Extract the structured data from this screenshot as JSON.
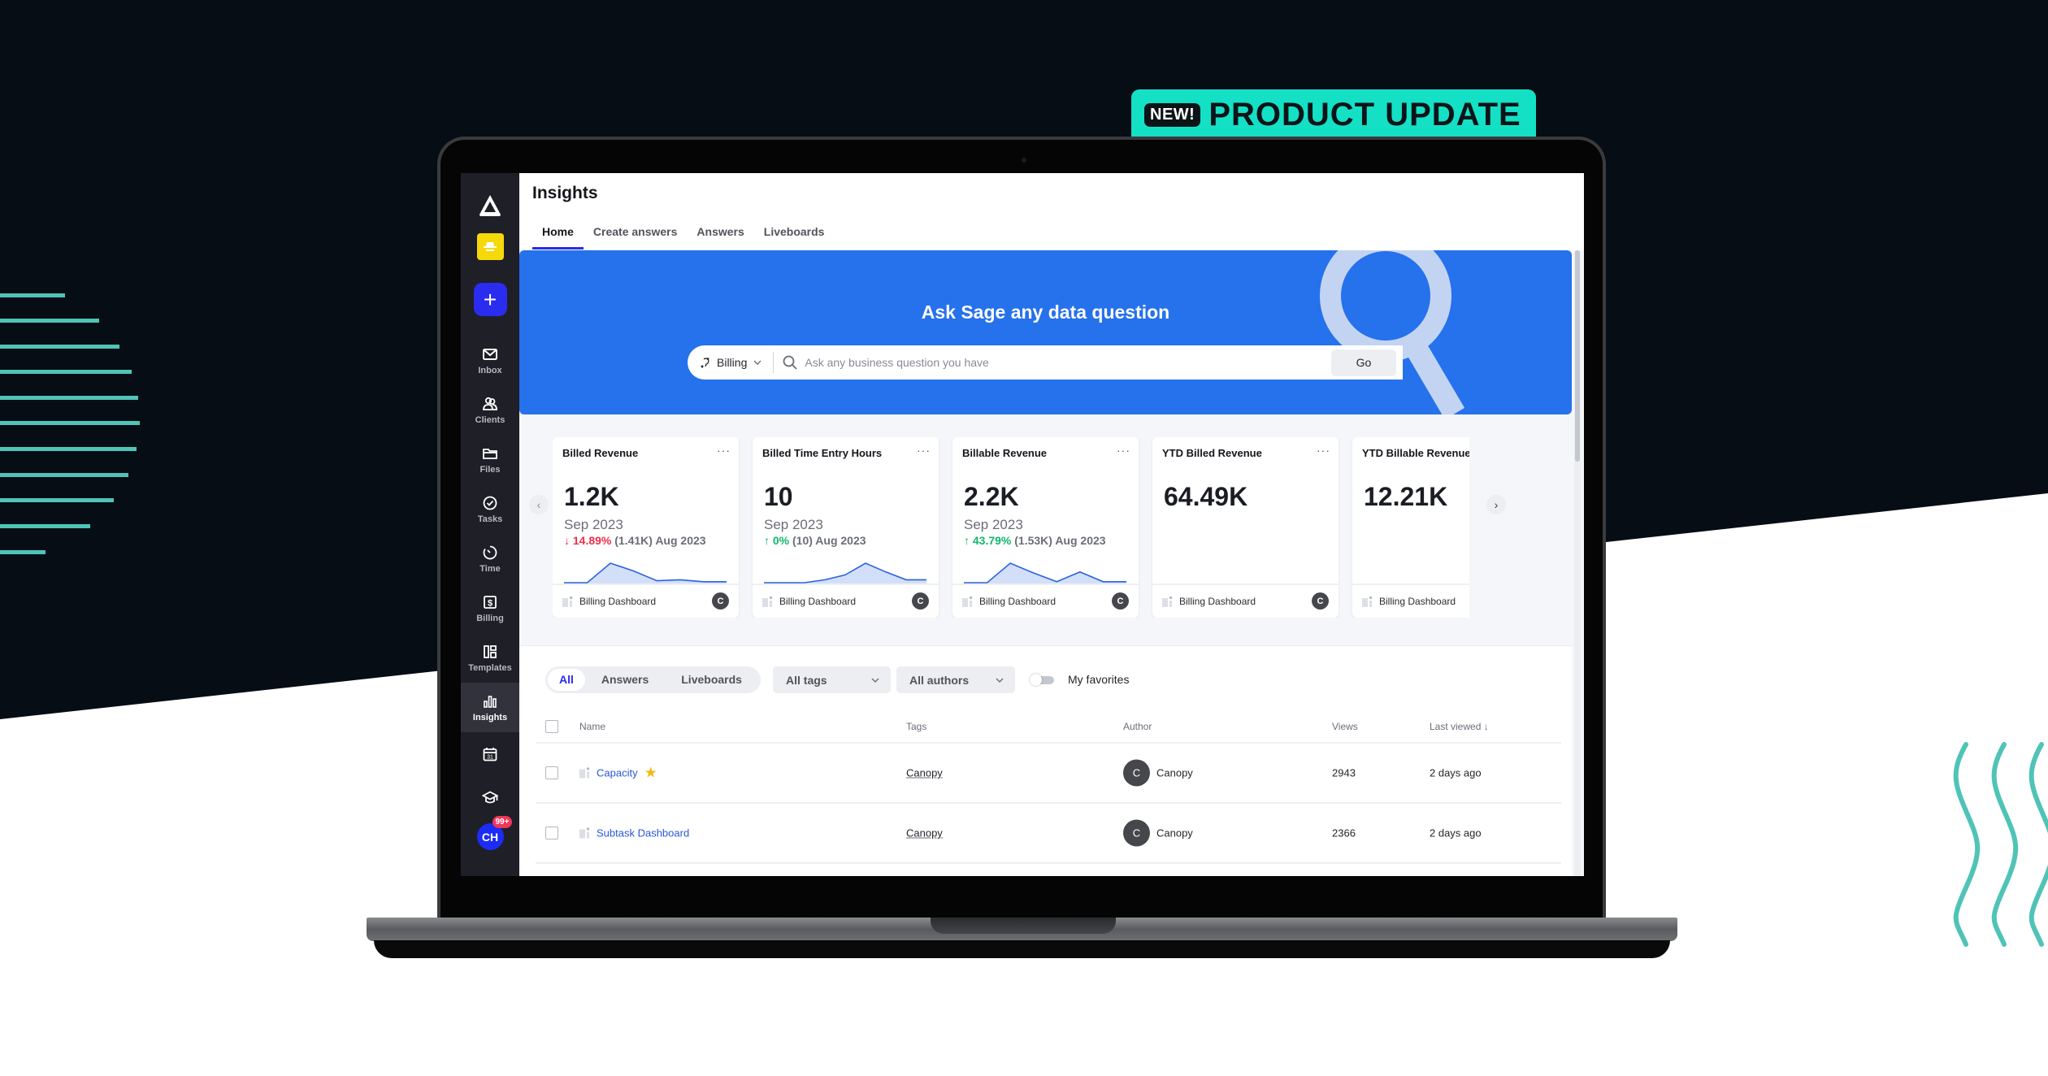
{
  "promo": {
    "badge": "NEW!",
    "title": "PRODUCT UPDATE",
    "accent": "#14e0c6",
    "background_dark": "#060d14"
  },
  "sidebar": {
    "items": [
      {
        "label": "Inbox",
        "icon": "mail-icon"
      },
      {
        "label": "Clients",
        "icon": "users-icon"
      },
      {
        "label": "Files",
        "icon": "folder-icon"
      },
      {
        "label": "Tasks",
        "icon": "check-circle-icon"
      },
      {
        "label": "Time",
        "icon": "timer-icon"
      },
      {
        "label": "Billing",
        "icon": "dollar-icon"
      },
      {
        "label": "Templates",
        "icon": "templates-icon"
      },
      {
        "label": "Insights",
        "icon": "bar-chart-icon",
        "active": true
      }
    ],
    "extra_icons": [
      "calendar-icon",
      "graduation-cap-icon"
    ],
    "avatar": {
      "initials": "CH",
      "badge": "99+"
    }
  },
  "header": {
    "title": "Insights",
    "tabs": [
      {
        "label": "Home",
        "active": true
      },
      {
        "label": "Create answers"
      },
      {
        "label": "Answers"
      },
      {
        "label": "Liveboards"
      }
    ]
  },
  "hero": {
    "title": "Ask Sage any data question",
    "scope": "Billing",
    "search_value": "",
    "search_placeholder": "Ask any business question you have",
    "go_label": "Go",
    "accent": "#2671ec"
  },
  "kpis": [
    {
      "title": "Billed Revenue",
      "value": "1.2K",
      "period": "Sep 2023",
      "direction": "down",
      "arrow": "↓",
      "delta": "14.89%",
      "compare": "(1.41K) Aug 2023",
      "source": "Billing Dashboard",
      "author": "C",
      "spark": [
        0,
        0,
        1,
        0.6,
        0.1,
        0.15,
        0.05,
        0.05
      ],
      "show_menu": true
    },
    {
      "title": "Billed Time Entry Hours",
      "value": "10",
      "period": "Sep 2023",
      "direction": "up",
      "arrow": "↑",
      "delta": "0%",
      "compare": "(10) Aug 2023",
      "source": "Billing Dashboard",
      "author": "C",
      "spark": [
        0,
        0,
        0,
        0.15,
        0.4,
        1,
        0.55,
        0.15,
        0.15
      ],
      "show_menu": true
    },
    {
      "title": "Billable Revenue",
      "value": "2.2K",
      "period": "Sep 2023",
      "direction": "up",
      "arrow": "↑",
      "delta": "43.79%",
      "compare": "(1.53K) Aug 2023",
      "source": "Billing Dashboard",
      "author": "C",
      "spark": [
        0,
        0,
        1,
        0.5,
        0.05,
        0.55,
        0.05,
        0.05
      ],
      "show_menu": true
    },
    {
      "title": "YTD Billed Revenue",
      "value": "64.49K",
      "period": "",
      "direction": "",
      "arrow": "",
      "delta": "",
      "compare": "",
      "source": "Billing Dashboard",
      "author": "C",
      "spark": [],
      "show_menu": true
    },
    {
      "title": "YTD Billable Revenue",
      "value": "12.21K",
      "period": "",
      "direction": "",
      "arrow": "",
      "delta": "",
      "compare": "",
      "source": "Billing Dashboard",
      "author": "",
      "spark": [],
      "show_menu": false
    }
  ],
  "filters": {
    "segments": [
      {
        "label": "All",
        "active": true
      },
      {
        "label": "Answers"
      },
      {
        "label": "Liveboards"
      }
    ],
    "tags": "All tags",
    "authors": "All authors",
    "favorites_label": "My favorites",
    "favorites_on": false
  },
  "table": {
    "columns": {
      "name": "Name",
      "tags": "Tags",
      "author": "Author",
      "views": "Views",
      "last_viewed": "Last viewed ↓"
    },
    "rows": [
      {
        "name": "Capacity",
        "favorite": true,
        "tag": "Canopy",
        "author_initial": "C",
        "author": "Canopy",
        "views": "2943",
        "last_viewed": "2 days ago"
      },
      {
        "name": "Subtask Dashboard",
        "favorite": false,
        "tag": "Canopy",
        "author_initial": "C",
        "author": "Canopy",
        "views": "2366",
        "last_viewed": "2 days ago"
      }
    ]
  }
}
